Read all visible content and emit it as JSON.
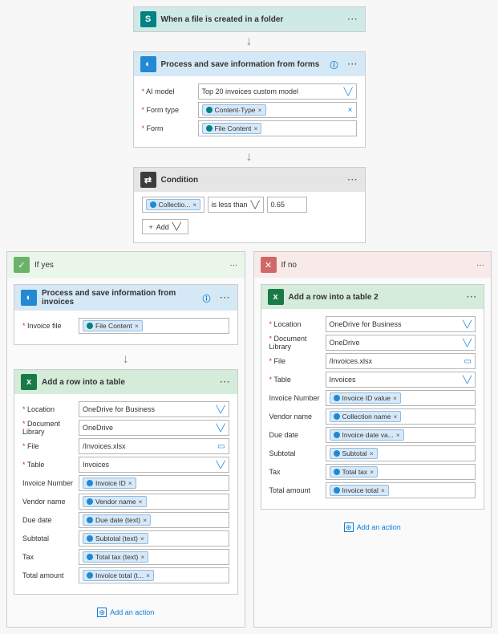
{
  "trigger": {
    "title": "When a file is created in a folder"
  },
  "process1": {
    "title": "Process and save information from forms",
    "fields": {
      "ai_model": {
        "label": "AI model",
        "value": "Top 20 invoices custom model"
      },
      "form_type": {
        "label": "Form type",
        "token": "Content-Type"
      },
      "form": {
        "label": "Form",
        "token": "File Content"
      }
    }
  },
  "condition": {
    "title": "Condition",
    "left_token": "Collectio...",
    "operator": "is less than",
    "value": "0.65",
    "add_label": "Add"
  },
  "branch_yes": {
    "label": "If yes"
  },
  "branch_no": {
    "label": "If no"
  },
  "process2": {
    "title": "Process and save information from invoices",
    "invoice_file": {
      "label": "Invoice file",
      "token": "File Content"
    }
  },
  "addrow1": {
    "title": "Add a row into a table",
    "location": {
      "label": "Location",
      "value": "OneDrive for Business"
    },
    "doclib": {
      "label": "Document Library",
      "value": "OneDrive"
    },
    "file": {
      "label": "File",
      "value": "/Invoices.xlsx"
    },
    "table": {
      "label": "Table",
      "value": "Invoices"
    },
    "invoice_number": {
      "label": "Invoice Number",
      "token": "Invoice ID"
    },
    "vendor_name": {
      "label": "Vendor name",
      "token": "Vendor name"
    },
    "due_date": {
      "label": "Due date",
      "token": "Due date (text)"
    },
    "subtotal": {
      "label": "Subtotal",
      "token": "Subtotal (text)"
    },
    "tax": {
      "label": "Tax",
      "token": "Total tax (text)"
    },
    "total_amount": {
      "label": "Total amount",
      "token": "Invoice total (t..."
    }
  },
  "addrow2": {
    "title": "Add a row into a table 2",
    "location": {
      "label": "Location",
      "value": "OneDrive for Business"
    },
    "doclib": {
      "label": "Document Library",
      "value": "OneDrive"
    },
    "file": {
      "label": "File",
      "value": "/Invoices.xlsx"
    },
    "table": {
      "label": "Table",
      "value": "Invoices"
    },
    "invoice_number": {
      "label": "Invoice Number",
      "token": "Invoice ID value"
    },
    "vendor_name": {
      "label": "Vendor name",
      "token": "Collection name"
    },
    "due_date": {
      "label": "Due date",
      "token": "Invoice date va..."
    },
    "subtotal": {
      "label": "Subtotal",
      "token": "Subtotal"
    },
    "tax": {
      "label": "Tax",
      "token": "Total tax"
    },
    "total_amount": {
      "label": "Total amount",
      "token": "Invoice total"
    }
  },
  "add_action_label": "Add an action"
}
